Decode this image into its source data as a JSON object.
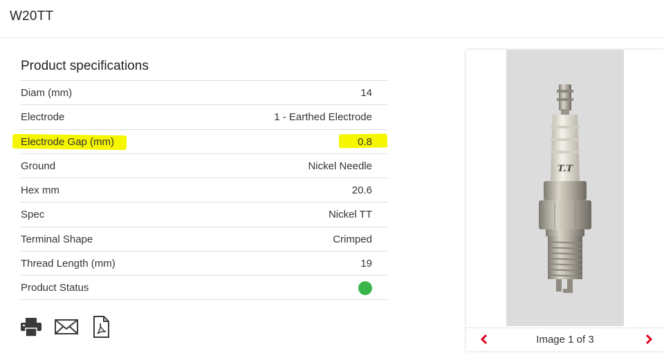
{
  "product": {
    "title": "W20TT"
  },
  "specifications": {
    "heading": "Product specifications",
    "rows": [
      {
        "label": "Diam (mm)",
        "value": "14"
      },
      {
        "label": "Electrode",
        "value": "1 - Earthed Electrode"
      },
      {
        "label": "Electrode Gap (mm)",
        "value": "0.8"
      },
      {
        "label": "Ground",
        "value": "Nickel Needle"
      },
      {
        "label": "Hex mm",
        "value": "20.6"
      },
      {
        "label": "Spec",
        "value": "Nickel TT"
      },
      {
        "label": "Terminal Shape",
        "value": "Crimped"
      },
      {
        "label": "Thread Length (mm)",
        "value": "19"
      },
      {
        "label": "Product Status",
        "value": ""
      }
    ],
    "highlight_color": "#f6f600",
    "status_color": "#3ab54a"
  },
  "actions": {
    "icons": [
      "print-icon",
      "email-icon",
      "pdf-icon"
    ]
  },
  "gallery": {
    "counter_text": "Image 1 of 3",
    "nav_color": "#e2001a",
    "plug_brand_text": "T.T"
  }
}
